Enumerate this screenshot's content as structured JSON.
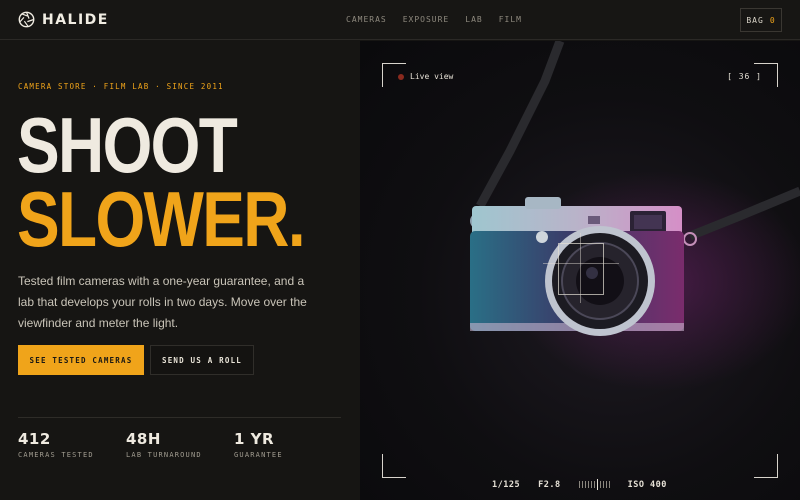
{
  "brand": {
    "name": "HALIDE",
    "icon": "aperture-icon"
  },
  "nav": {
    "items": [
      "CAMERAS",
      "EXPOSURE",
      "LAB",
      "FILM"
    ]
  },
  "bag": {
    "label": "BAG",
    "count": "0"
  },
  "hero": {
    "kicker": "CAMERA STORE · FILM LAB · SINCE 2011",
    "title_line1": "SHOOT",
    "title_line2": "SLOWER.",
    "lede": "Tested film cameras with a one-year guarantee, and a lab that develops your rolls in two days. Move over the viewfinder and meter the light.",
    "primary_cta": "SEE TESTED CAMERAS",
    "secondary_cta": "SEND US A ROLL"
  },
  "stats": [
    {
      "value": "412",
      "label": "CAMERAS TESTED"
    },
    {
      "value": "48H",
      "label": "LAB TURNAROUND"
    },
    {
      "value": "1 YR",
      "label": "GUARANTEE"
    }
  ],
  "viewfinder": {
    "live_label": "Live view",
    "shots_remaining": "[ 36 ]",
    "shutter": "1/125",
    "aperture": "F2.8",
    "iso": "ISO 400"
  },
  "colors": {
    "accent": "#f0a41a",
    "background": "#161513",
    "text": "#efeae0"
  }
}
